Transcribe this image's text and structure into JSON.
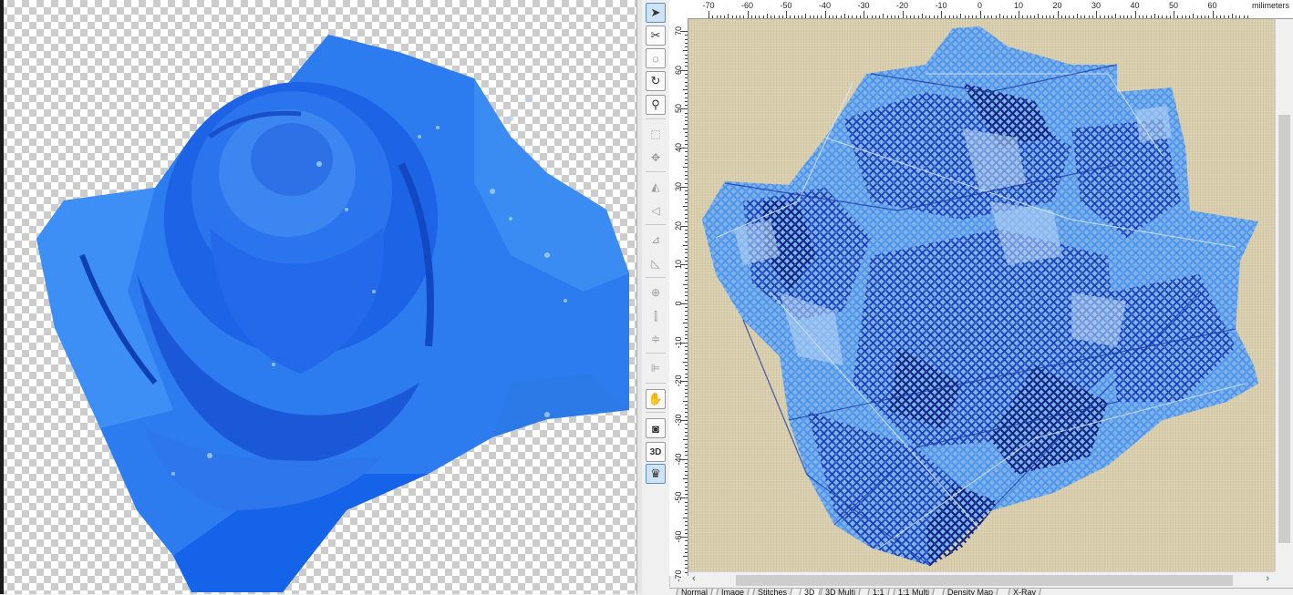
{
  "ruler": {
    "unit": "milimeters",
    "top_labels": [
      "-70",
      "-60",
      "-50",
      "-40",
      "-30",
      "-20",
      "-10",
      "0",
      "10",
      "20",
      "30",
      "40",
      "50",
      "60"
    ],
    "left_labels": [
      "70",
      "60",
      "50",
      "40",
      "30",
      "20",
      "10",
      "0",
      "-10",
      "-20",
      "-30",
      "-40",
      "-50",
      "-60",
      "-70"
    ]
  },
  "toolbar": {
    "tools": [
      {
        "name": "select-arrow-icon",
        "glyph": "➤",
        "active": true
      },
      {
        "name": "lasso-select-icon",
        "glyph": "✂",
        "active": false
      },
      {
        "name": "freehand-select-icon",
        "glyph": "◌",
        "active": false
      },
      {
        "name": "rotate-icon",
        "glyph": "↻",
        "active": false
      },
      {
        "name": "zoom-icon",
        "glyph": "⚲",
        "active": false
      },
      {
        "name": "resize-icon",
        "glyph": "⬚",
        "active": false,
        "faint": true
      },
      {
        "name": "move-icon",
        "glyph": "✥",
        "active": false,
        "faint": true
      },
      {
        "name": "mirror-vertical-icon",
        "glyph": "◭",
        "active": false,
        "faint": true
      },
      {
        "name": "mirror-horizontal-icon",
        "glyph": "◁",
        "active": false,
        "faint": true
      },
      {
        "name": "flip-left-icon",
        "glyph": "⊿",
        "active": false,
        "faint": true
      },
      {
        "name": "flip-right-icon",
        "glyph": "◺",
        "active": false,
        "faint": true
      },
      {
        "name": "center-icon",
        "glyph": "⊕",
        "active": false,
        "faint": true
      },
      {
        "name": "center-horizontal-icon",
        "glyph": "⫿",
        "active": false,
        "faint": true
      },
      {
        "name": "center-vertical-icon",
        "glyph": "≑",
        "active": false,
        "faint": true
      },
      {
        "name": "align-icon",
        "glyph": "⊫",
        "active": false,
        "faint": true
      },
      {
        "name": "hand-stitch-icon",
        "glyph": "✋",
        "active": false
      },
      {
        "name": "page-view-icon",
        "glyph": "◙",
        "active": false
      },
      {
        "name": "3d-view-icon",
        "glyph": "3D",
        "active": false
      },
      {
        "name": "fabric-view-icon",
        "glyph": "♛",
        "active": true
      }
    ]
  },
  "tabs": [
    {
      "label": "Normal",
      "active": false
    },
    {
      "label": "Image",
      "active": false
    },
    {
      "label": "Stitches",
      "active": false
    },
    {
      "label": "3D",
      "active": true
    },
    {
      "label": "3D Multi",
      "active": false
    },
    {
      "label": "1:1",
      "active": false
    },
    {
      "label": "1:1 Multi",
      "active": false
    },
    {
      "label": "Density Map",
      "active": false
    },
    {
      "label": "X-Ray",
      "active": false
    }
  ],
  "colors": {
    "fabric": "#d9cfae",
    "rose_light": "#3a8bf0",
    "rose_mid": "#1f5fe0",
    "rose_dark": "#1530a8"
  }
}
